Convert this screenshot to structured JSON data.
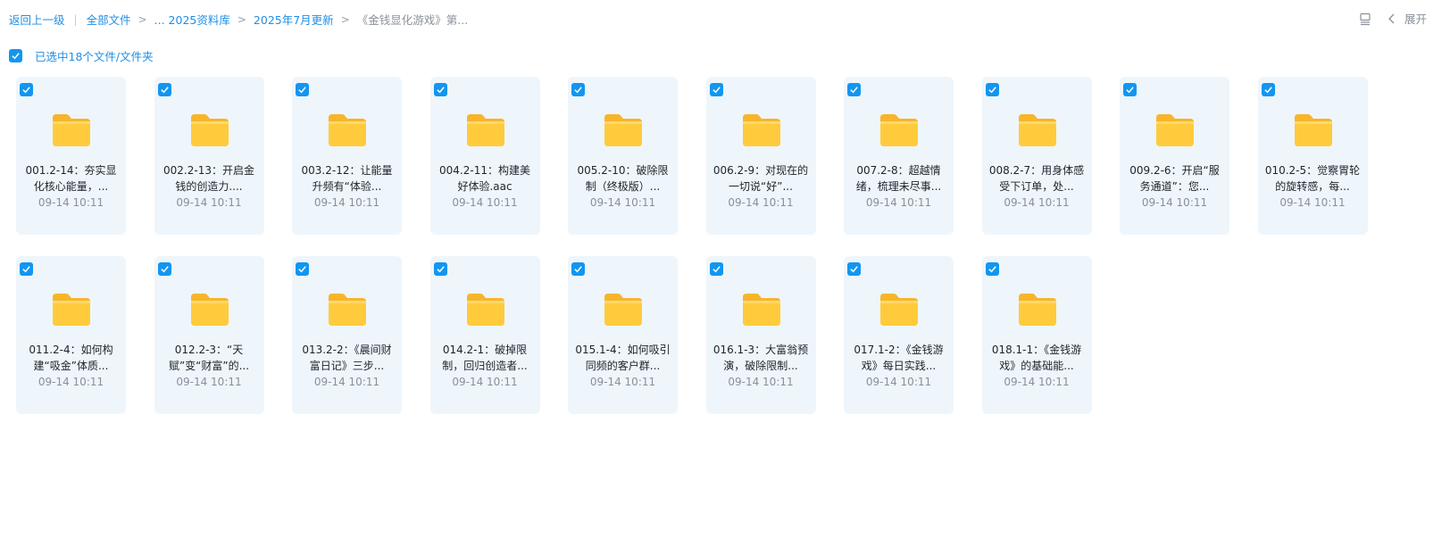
{
  "breadcrumb": {
    "back": "返回上一级",
    "items": [
      "全部文件",
      "... 2025资料库",
      "2025年7月更新"
    ],
    "current": "《金钱显化游戏》第..."
  },
  "toolbar": {
    "expand_label": "展开",
    "view_icon": "list-view-icon",
    "collapse_icon": "chevron-left-icon"
  },
  "selection": {
    "label": "已选中18个文件/文件夹"
  },
  "colors": {
    "accent": "#1296f0",
    "card_bg": "#eef6fc",
    "folder": "#ffc83a"
  },
  "files": [
    {
      "name": "001.2-14：夯实显化核心能量，...",
      "time": "09-14 10:11"
    },
    {
      "name": "002.2-13：开启金钱的创造力....",
      "time": "09-14 10:11"
    },
    {
      "name": "003.2-12：让能量升频有“体验...",
      "time": "09-14 10:11"
    },
    {
      "name": "004.2-11：构建美好体验.aac",
      "time": "09-14 10:11"
    },
    {
      "name": "005.2-10：破除限制（终极版）...",
      "time": "09-14 10:11"
    },
    {
      "name": "006.2-9：对现在的一切说“好”...",
      "time": "09-14 10:11"
    },
    {
      "name": "007.2-8：超越情绪，梳理未尽事...",
      "time": "09-14 10:11"
    },
    {
      "name": "008.2-7：用身体感受下订单，处...",
      "time": "09-14 10:11"
    },
    {
      "name": "009.2-6：开启“服务通道”：您...",
      "time": "09-14 10:11"
    },
    {
      "name": "010.2-5：觉察胃轮的旋转感，每...",
      "time": "09-14 10:11"
    },
    {
      "name": "011.2-4：如何构建“吸金”体质...",
      "time": "09-14 10:11"
    },
    {
      "name": "012.2-3：“天赋”变“财富”的...",
      "time": "09-14 10:11"
    },
    {
      "name": "013.2-2：《晨间财富日记》三步...",
      "time": "09-14 10:11"
    },
    {
      "name": "014.2-1：破掉限制，回归创造者...",
      "time": "09-14 10:11"
    },
    {
      "name": "015.1-4：如何吸引同频的客户群...",
      "time": "09-14 10:11"
    },
    {
      "name": "016.1-3：大富翁预演，破除限制...",
      "time": "09-14 10:11"
    },
    {
      "name": "017.1-2：《金钱游戏》每日实践...",
      "time": "09-14 10:11"
    },
    {
      "name": "018.1-1：《金钱游戏》的基础能...",
      "time": "09-14 10:11"
    }
  ]
}
